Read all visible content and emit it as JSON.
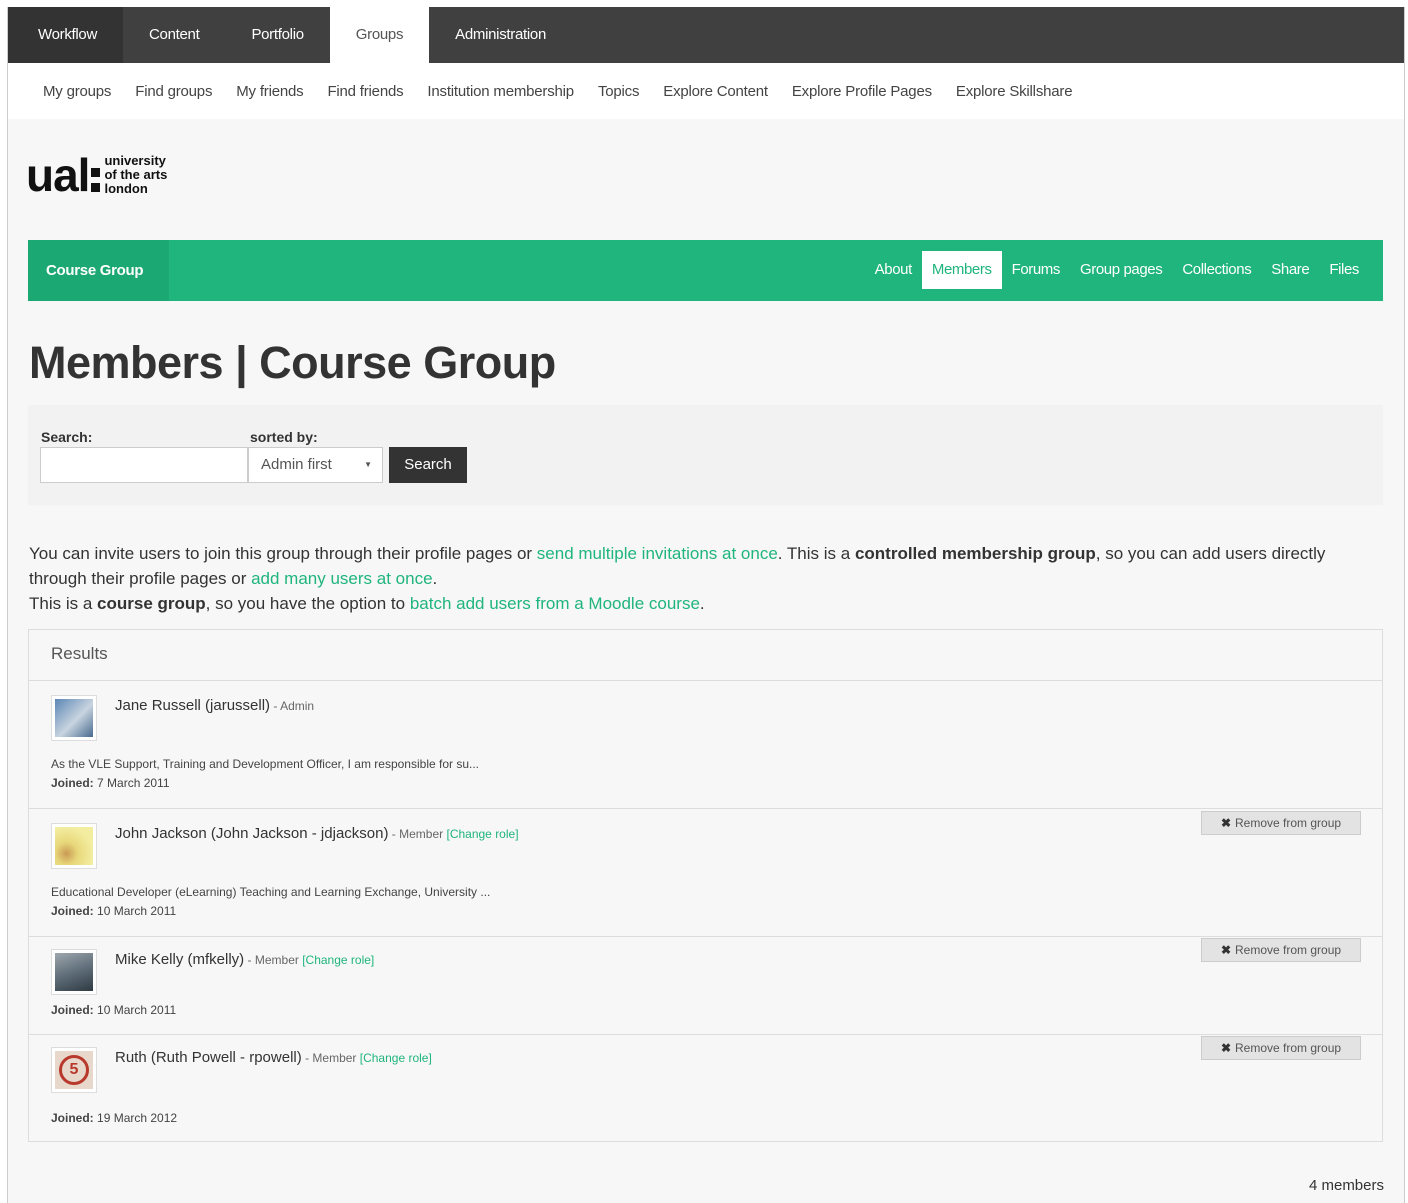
{
  "topnav": {
    "tabs": [
      {
        "label": "Workflow"
      },
      {
        "label": "Content"
      },
      {
        "label": "Portfolio"
      },
      {
        "label": "Groups"
      },
      {
        "label": "Administration"
      }
    ]
  },
  "subnav": {
    "items": [
      "My groups",
      "Find groups",
      "My friends",
      "Find friends",
      "Institution membership",
      "Topics",
      "Explore Content",
      "Explore Profile Pages",
      "Explore Skillshare"
    ]
  },
  "logo": {
    "short": "ual",
    "line1": "university",
    "line2": "of the arts",
    "line3": "london"
  },
  "group": {
    "name": "Course Group",
    "tabs": [
      "About",
      "Members",
      "Forums",
      "Group pages",
      "Collections",
      "Share",
      "Files"
    ]
  },
  "page_title": "Members | Course Group",
  "search": {
    "label": "Search:",
    "sorted_label": "sorted by:",
    "sort_value": "Admin first",
    "button": "Search"
  },
  "intro": {
    "p1_a": "You can invite users to join this group through their profile pages or ",
    "p1_link1": "send multiple invitations at once",
    "p1_b": ". This is a ",
    "p1_bold": "controlled membership group",
    "p1_c": ", so you can add users directly through their profile pages or ",
    "p1_link2": "add many users at once",
    "p1_d": ".",
    "p2_a": "This is a ",
    "p2_bold": "course group",
    "p2_b": ", so you have the option to ",
    "p2_link": "batch add users from a Moodle course",
    "p2_c": "."
  },
  "results": {
    "heading": "Results",
    "joined_label": "Joined:",
    "remove_label": "Remove from group",
    "members": [
      {
        "name": "Jane Russell (jarussell)",
        "role": " - Admin",
        "change": "",
        "desc": "As the VLE Support, Training and Development Officer, I am responsible for su...",
        "joined": "7 March 2011"
      },
      {
        "name": "John Jackson (John Jackson - jdjackson)",
        "role": " - Member ",
        "change": "[Change role]",
        "desc": "Educational Developer (eLearning) Teaching and Learning Exchange, University ...",
        "joined": "10 March 2011"
      },
      {
        "name": "Mike Kelly (mfkelly)",
        "role": " - Member ",
        "change": "[Change role]",
        "desc": "",
        "joined": "10 March 2011"
      },
      {
        "name": "Ruth (Ruth Powell - rpowell)",
        "role": " - Member ",
        "change": "[Change role]",
        "desc": "",
        "joined": "19 March 2012"
      }
    ],
    "count": "4 members"
  },
  "colors": {
    "accent": "#1fb57d",
    "topnav": "#404040"
  }
}
